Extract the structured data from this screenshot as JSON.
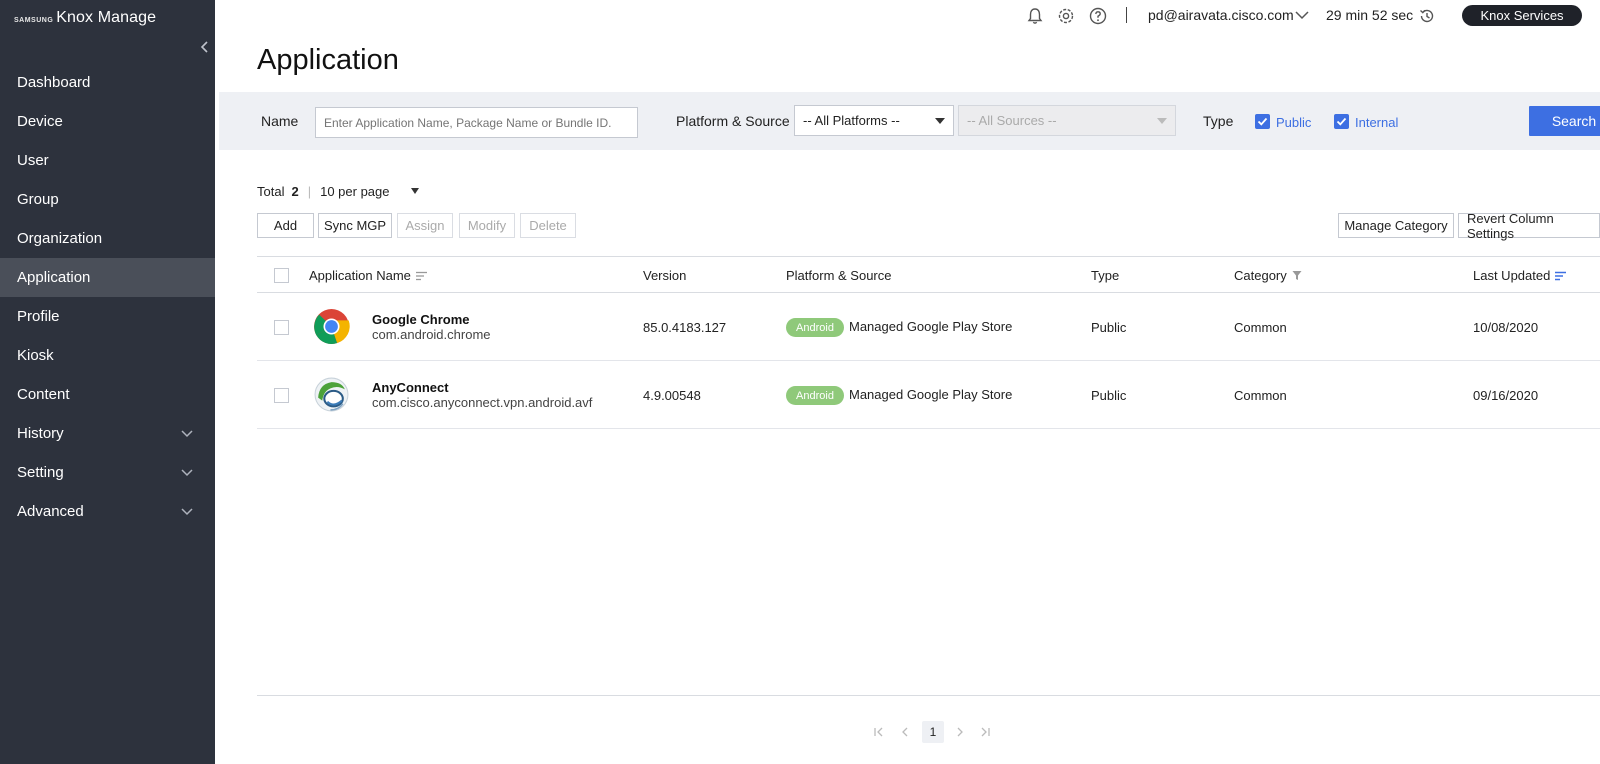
{
  "app": {
    "brand_small": "SAMSUNG",
    "brand_main": "Knox Manage"
  },
  "sidebar": {
    "items": [
      {
        "label": "Dashboard",
        "expandable": false,
        "active": false
      },
      {
        "label": "Device",
        "expandable": false,
        "active": false
      },
      {
        "label": "User",
        "expandable": false,
        "active": false
      },
      {
        "label": "Group",
        "expandable": false,
        "active": false
      },
      {
        "label": "Organization",
        "expandable": false,
        "active": false
      },
      {
        "label": "Application",
        "expandable": false,
        "active": true
      },
      {
        "label": "Profile",
        "expandable": false,
        "active": false
      },
      {
        "label": "Kiosk",
        "expandable": false,
        "active": false
      },
      {
        "label": "Content",
        "expandable": false,
        "active": false
      },
      {
        "label": "History",
        "expandable": true,
        "active": false
      },
      {
        "label": "Setting",
        "expandable": true,
        "active": false
      },
      {
        "label": "Advanced",
        "expandable": true,
        "active": false
      }
    ]
  },
  "topbar": {
    "user_email": "pd@airavata.cisco.com",
    "session_timer": "29 min 52 sec",
    "knox_services_label": "Knox Services",
    "icons": [
      "bell-icon",
      "gear-icon",
      "help-icon",
      "history-refresh-icon"
    ]
  },
  "page": {
    "title": "Application"
  },
  "filters": {
    "name_label": "Name",
    "name_placeholder": "Enter Application Name, Package Name or Bundle ID.",
    "platform_source_label": "Platform & Source",
    "platform_select_value": "-- All Platforms --",
    "source_select_value": "-- All Sources --",
    "type_label": "Type",
    "type_public_label": "Public",
    "type_internal_label": "Internal",
    "type_public_checked": true,
    "type_internal_checked": true,
    "search_label": "Search"
  },
  "list_info": {
    "total_label": "Total",
    "total_count": "2",
    "per_page": "10 per page"
  },
  "actions": {
    "add": "Add",
    "sync_mgp": "Sync MGP",
    "assign": "Assign",
    "modify": "Modify",
    "delete": "Delete",
    "manage_category": "Manage Category",
    "revert_column_settings": "Revert Column Settings"
  },
  "table": {
    "columns": {
      "app_name": "Application Name",
      "version": "Version",
      "platform_source": "Platform & Source",
      "type": "Type",
      "category": "Category",
      "last_updated": "Last Updated"
    },
    "rows": [
      {
        "name": "Google Chrome",
        "package": "com.android.chrome",
        "icon": "chrome-icon",
        "version": "85.0.4183.127",
        "platform_badge": "Android",
        "source": "Managed Google Play Store",
        "type": "Public",
        "category": "Common",
        "last_updated": "10/08/2020"
      },
      {
        "name": "AnyConnect",
        "package": "com.cisco.anyconnect.vpn.android.avf",
        "icon": "anyconnect-icon",
        "version": "4.9.00548",
        "platform_badge": "Android",
        "source": "Managed Google Play Store",
        "type": "Public",
        "category": "Common",
        "last_updated": "09/16/2020"
      }
    ]
  },
  "pagination": {
    "current_page": "1"
  },
  "colors": {
    "sidebar_bg": "#2d323d",
    "sidebar_active": "#4a4f59",
    "accent": "#3d6fe2",
    "android_badge": "#8fc97a",
    "filter_bg": "#eef0f4"
  }
}
